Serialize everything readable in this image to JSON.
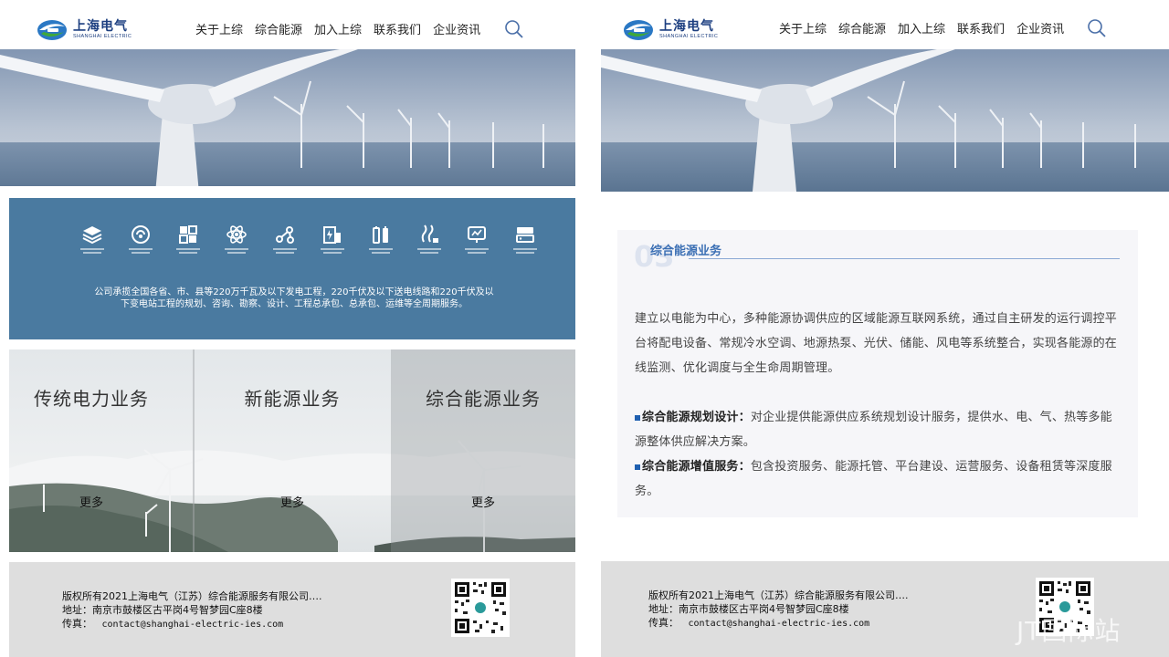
{
  "brand": {
    "name_cn": "上海电气",
    "name_en": "SHANGHAI ELECTRIC",
    "primary_color": "#1d3f80",
    "accent_green": "#3fa83a",
    "accent_blue": "#2a78c4"
  },
  "nav": {
    "items": [
      "关于上综",
      "综合能源",
      "加入上综",
      "联系我们",
      "企业资讯"
    ],
    "search_icon": "search-icon"
  },
  "left": {
    "band": {
      "color": "#4a7aa0",
      "services": [
        {
          "icon": "layers-icon"
        },
        {
          "icon": "cycle-icon"
        },
        {
          "icon": "grid-blocks-icon"
        },
        {
          "icon": "atom-icon"
        },
        {
          "icon": "network-nodes-icon"
        },
        {
          "icon": "substation-icon"
        },
        {
          "icon": "battery-icon"
        },
        {
          "icon": "heat-wave-icon"
        },
        {
          "icon": "monitor-icon"
        },
        {
          "icon": "server-icon"
        }
      ],
      "description": "公司承揽全国各省、市、县等220万千瓦及以下发电工程，220千伏及以下送电线路和220千伏及以下变电站工程的规划、咨询、勘察、设计、工程总承包、总承包、运维等全周期服务。"
    },
    "business": [
      {
        "title": "传统电力业务",
        "more": "更多"
      },
      {
        "title": "新能源业务",
        "more": "更多"
      },
      {
        "title": "综合能源业务",
        "more": "更多"
      }
    ]
  },
  "right": {
    "card": {
      "number": "03",
      "title": "综合能源业务",
      "intro": "建立以电能为中心，多种能源协调供应的区域能源互联网系统，通过自主研发的运行调控平台将配电设备、常规冷水空调、地源热泵、光伏、储能、风电等系统整合，实现各能源的在线监测、优化调度与全生命周期管理。",
      "items": [
        {
          "label": "综合能源规划设计：",
          "text": "对企业提供能源供应系统规划设计服务，提供水、电、气、热等多能源整体供应解决方案。"
        },
        {
          "label": "综合能源增值服务：",
          "text": "包含投资服务、能源托管、平台建设、运营服务、设备租赁等深度服务。"
        }
      ]
    }
  },
  "footer": {
    "copyright": "版权所有2021上海电气（江苏）综合能源服务有限公司….",
    "address_label": "地址：",
    "address": "南京市鼓楼区古平岗4号智梦园C座8楼",
    "fax_label": "传真：",
    "email": "contact@shanghai-electric-ies.com"
  },
  "watermark": "JT国际站"
}
